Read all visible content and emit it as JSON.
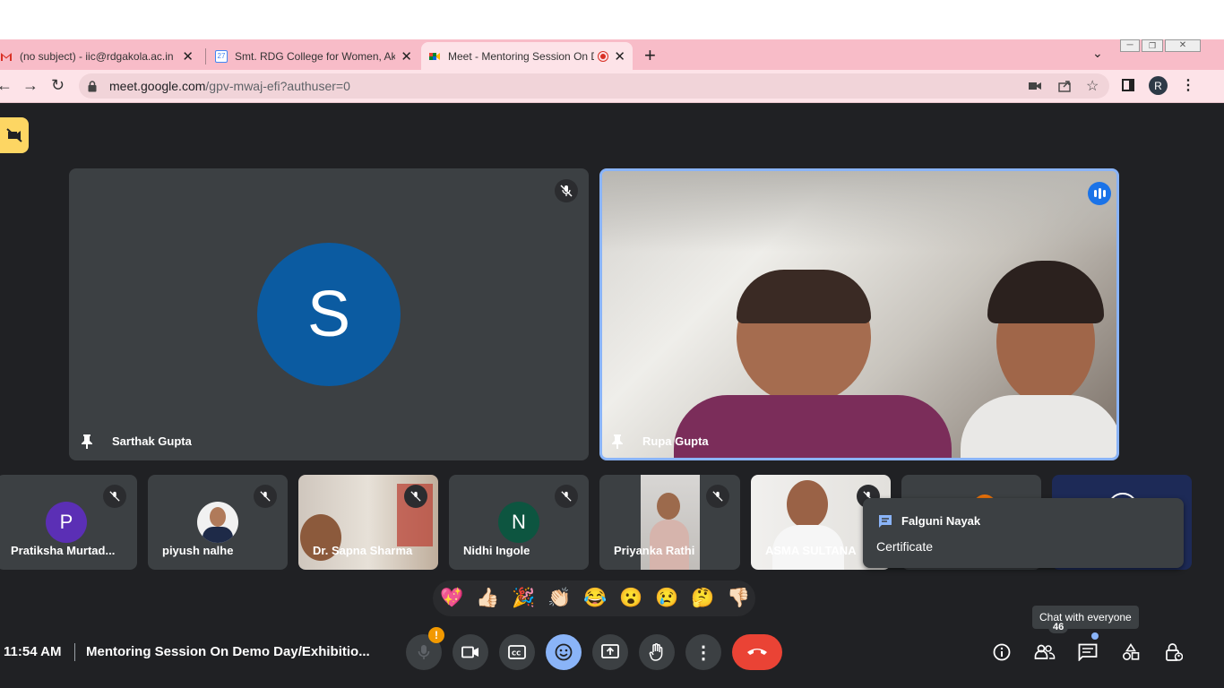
{
  "browser": {
    "tabs": [
      {
        "title": "(no subject) - iic@rdgakola.ac.in - S"
      },
      {
        "title": "Smt. RDG College for Women, Akola"
      },
      {
        "title": "Meet - Mentoring Session On D"
      }
    ],
    "calendar_icon_text": "27",
    "url_host": "meet.google.com",
    "url_path": "/gpv-mwaj-efi?authuser=0",
    "profile_initial": "R"
  },
  "meet": {
    "main_tiles": [
      {
        "name": "Sarthak Gupta",
        "initial": "S",
        "avatar_color": "#0b5ba1"
      },
      {
        "name": "Rupa Gupta"
      }
    ],
    "strip": [
      {
        "name": "Pratiksha Murtad...",
        "initial": "P",
        "avatar_color": "#5b2fb5"
      },
      {
        "name": "piyush nalhe"
      },
      {
        "name": "Dr. Sapna Sharma"
      },
      {
        "name": "Nidhi Ingole",
        "initial": "N",
        "avatar_color": "#0d5540"
      },
      {
        "name": "Priyanka Rathi"
      },
      {
        "name": "ASMA SULTANA"
      }
    ],
    "chat_popup": {
      "sender": "Falguni Nayak",
      "message": "Certificate"
    },
    "reactions": [
      "💖",
      "👍🏻",
      "🎉",
      "👏🏻",
      "😂",
      "😮",
      "😢",
      "🤔",
      "👎🏻"
    ],
    "time": "11:54 AM",
    "meeting_title": "Mentoring Session On Demo Day/Exhibitio...",
    "mic_alert": "!",
    "tooltip": "Chat with everyone",
    "participant_count": "46",
    "accent_blue": "#8ab4f8",
    "end_call_red": "#ea4335"
  }
}
